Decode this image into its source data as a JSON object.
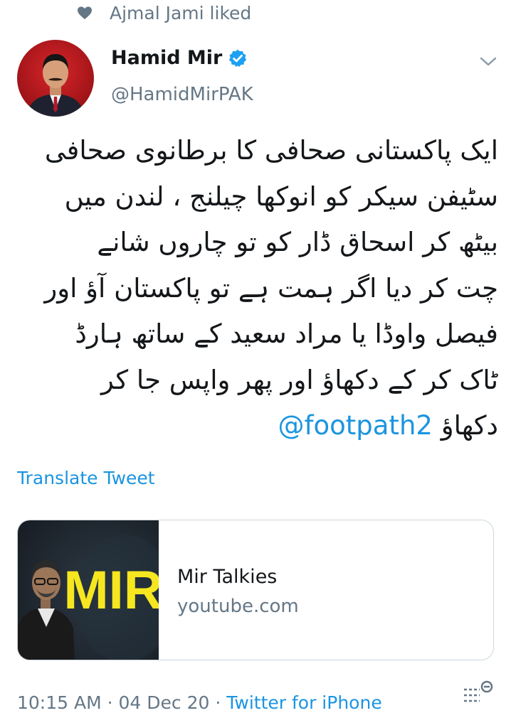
{
  "social_context": {
    "icon": "heart-icon",
    "text": "Ajmal Jami liked"
  },
  "author": {
    "name": "Hamid Mir",
    "handle": "@HamidMirPAK",
    "verified": true
  },
  "tweet": {
    "lines": [
      "ایک پاکستانی صحافی کا برطانوی صحافی",
      "سٹیفن سیکر کو انوکھا چیلنج ، لندن میں",
      "بیٹھ کر اسحاق ڈار کو تو چاروں شانے",
      "چت کر دیا اگر ہمت ہے تو پاکستان آؤ اور",
      "فیصل واوڈا یا مراد سعید کے ساتھ ہارڈ",
      "ٹاک کر کے دکھاؤ اور پھر واپس جا کر",
      "دکھاؤ"
    ],
    "mention": "@footpath2"
  },
  "translate_label": "Translate Tweet",
  "card": {
    "thumb_text": "MIR",
    "title": "Mir Talkies",
    "domain": "youtube.com"
  },
  "meta": {
    "time_date": "10:15 AM · 04 Dec 20 · ",
    "source": "Twitter for iPhone"
  },
  "colors": {
    "link": "#1b95e0",
    "secondary": "#657786",
    "verified": "#1da1f2",
    "text": "#14171a"
  }
}
